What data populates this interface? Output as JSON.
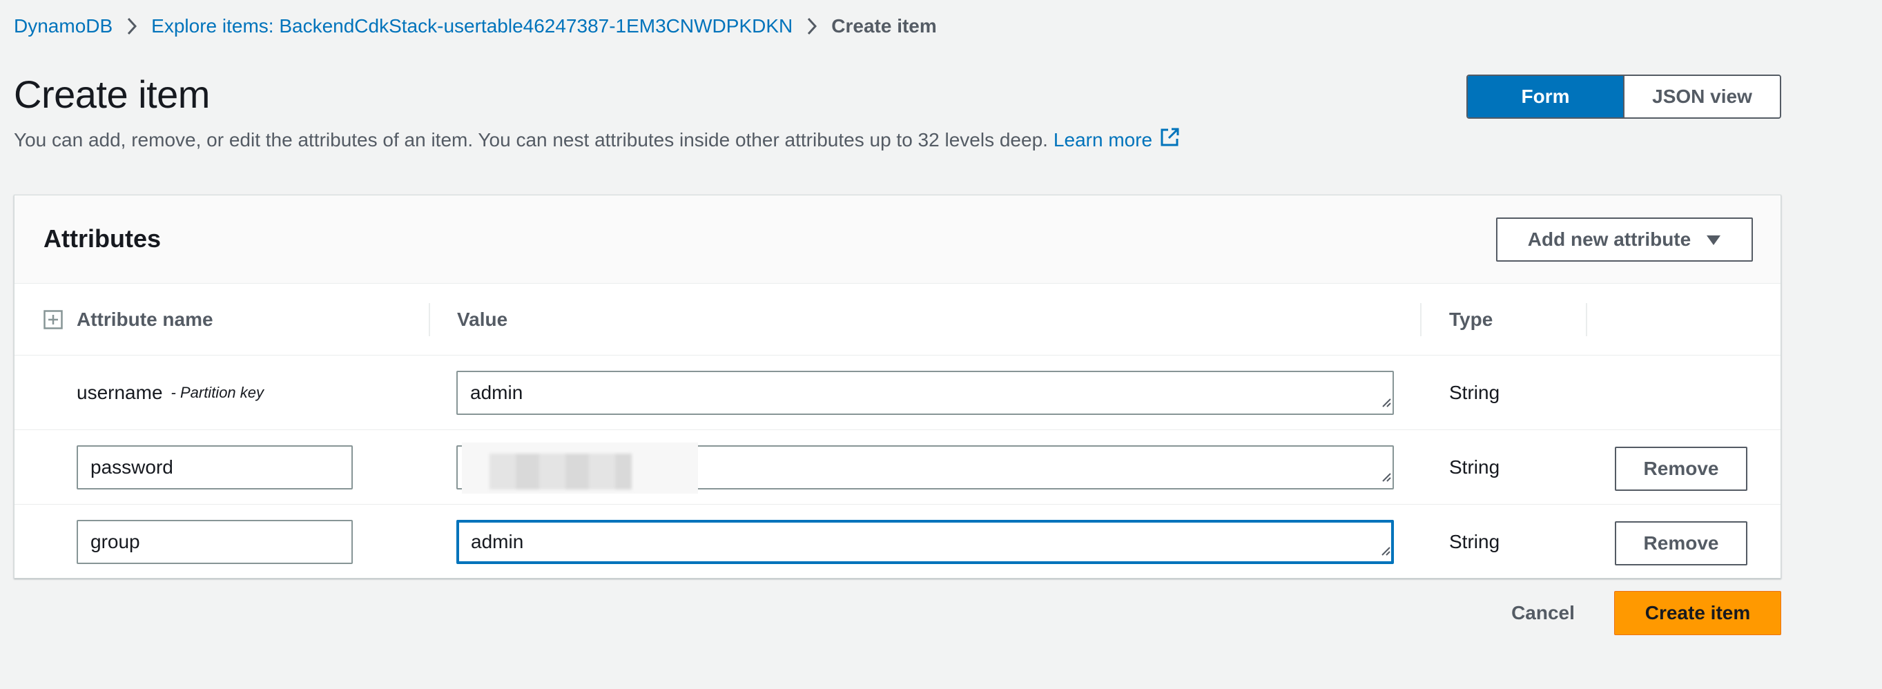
{
  "breadcrumb": {
    "items": [
      {
        "label": "DynamoDB"
      },
      {
        "label": "Explore items: BackendCdkStack-usertable46247387-1EM3CNWDPKDKN"
      },
      {
        "label": "Create item"
      }
    ]
  },
  "header": {
    "title": "Create item",
    "description": "You can add, remove, or edit the attributes of an item. You can nest attributes inside other attributes up to 32 levels deep.",
    "learn_more": "Learn more",
    "view_toggle": {
      "form": "Form",
      "json": "JSON view",
      "active": "form"
    }
  },
  "attributes": {
    "title": "Attributes",
    "add_button": "Add new attribute",
    "columns": {
      "name": "Attribute name",
      "value": "Value",
      "type": "Type"
    },
    "rows": [
      {
        "name": "username",
        "note": "- Partition key",
        "value": "admin",
        "type": "String"
      },
      {
        "name": "password",
        "value": "",
        "type": "String",
        "remove": "Remove",
        "value_redacted": true
      },
      {
        "name": "group",
        "value": "admin",
        "type": "String",
        "remove": "Remove",
        "focused": true
      }
    ]
  },
  "footer": {
    "cancel": "Cancel",
    "create": "Create item"
  },
  "colors": {
    "link": "#0073bb",
    "primary": "#ff9900",
    "toggle_active": "#0073bb",
    "background": "#f2f3f3"
  },
  "icons": [
    "chevron-right-icon",
    "external-link-icon",
    "caret-down-icon",
    "expand-all-icon",
    "resize-grip-icon"
  ]
}
